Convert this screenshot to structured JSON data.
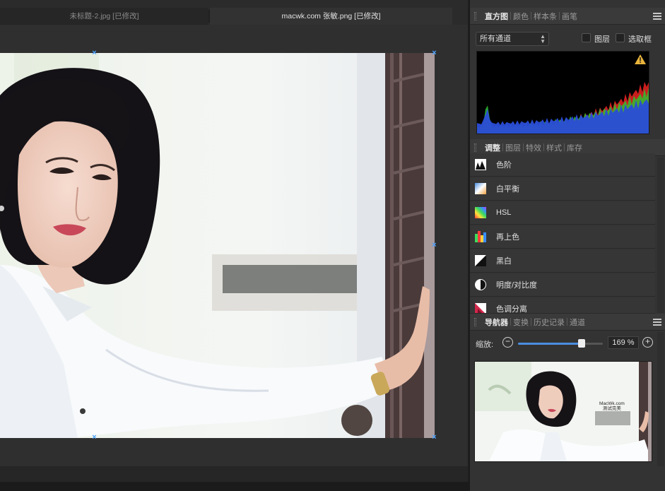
{
  "documents": {
    "tabs": [
      {
        "label": "未标题-2.jpg [已修改]",
        "active": false
      },
      {
        "label": "macwk.com 张敏.png [已修改]",
        "active": true
      }
    ]
  },
  "histogram_panel": {
    "tabs": [
      "直方图",
      "颜色",
      "样本条",
      "画笔"
    ],
    "active_tab": "直方图",
    "channel_select": "所有通道",
    "checkbox_layer": "图层",
    "checkbox_selection": "选取框",
    "warning_icon": "warning-triangle-icon"
  },
  "adjustments_panel": {
    "tabs": [
      "调整",
      "图层",
      "特效",
      "样式",
      "库存"
    ],
    "active_tab": "调整",
    "items": [
      {
        "label": "色阶",
        "icon": "levels-icon"
      },
      {
        "label": "白平衡",
        "icon": "white-balance-icon"
      },
      {
        "label": "HSL",
        "icon": "hsl-icon"
      },
      {
        "label": "再上色",
        "icon": "recolor-icon"
      },
      {
        "label": "黑白",
        "icon": "black-white-icon"
      },
      {
        "label": "明度/对比度",
        "icon": "brightness-contrast-icon"
      },
      {
        "label": "色调分离",
        "icon": "posterize-icon"
      }
    ]
  },
  "navigator_panel": {
    "tabs": [
      "导航器",
      "变换",
      "历史记录",
      "通道"
    ],
    "active_tab": "导航器",
    "zoom_label": "缩放:",
    "zoom_value": "169 %",
    "zoom_slider_fraction": 0.75,
    "thumbnail_caption_line1": "MacWk.com",
    "thumbnail_caption_line2": "测试完美"
  },
  "colors": {
    "selection_accent": "#4aa3ff",
    "slider_fill": "#4a8fe0"
  }
}
